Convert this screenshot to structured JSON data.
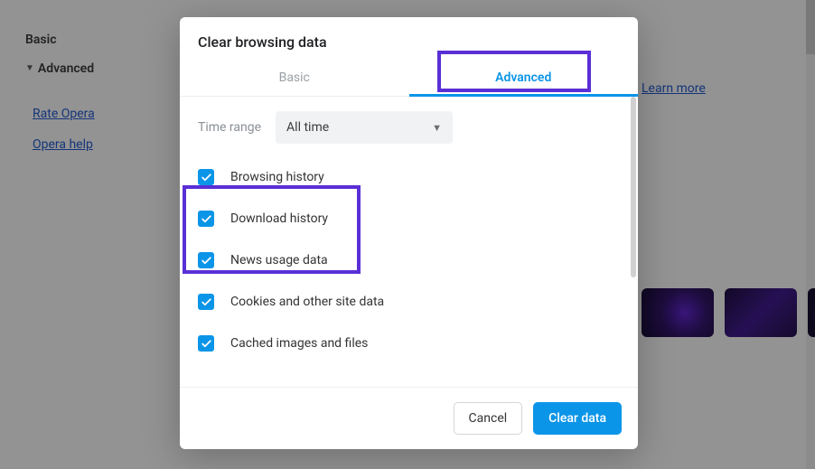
{
  "sidebar": {
    "basic": "Basic",
    "advanced": "Advanced",
    "rate": "Rate Opera",
    "help": "Opera help"
  },
  "background": {
    "learn_more": "Learn more"
  },
  "dialog": {
    "title": "Clear browsing data",
    "tabs": {
      "basic": "Basic",
      "advanced": "Advanced"
    },
    "time_label": "Time range",
    "time_value": "All time",
    "options": [
      "Browsing history",
      "Download history",
      "News usage data",
      "Cookies and other site data",
      "Cached images and files"
    ],
    "buttons": {
      "cancel": "Cancel",
      "clear": "Clear data"
    }
  }
}
